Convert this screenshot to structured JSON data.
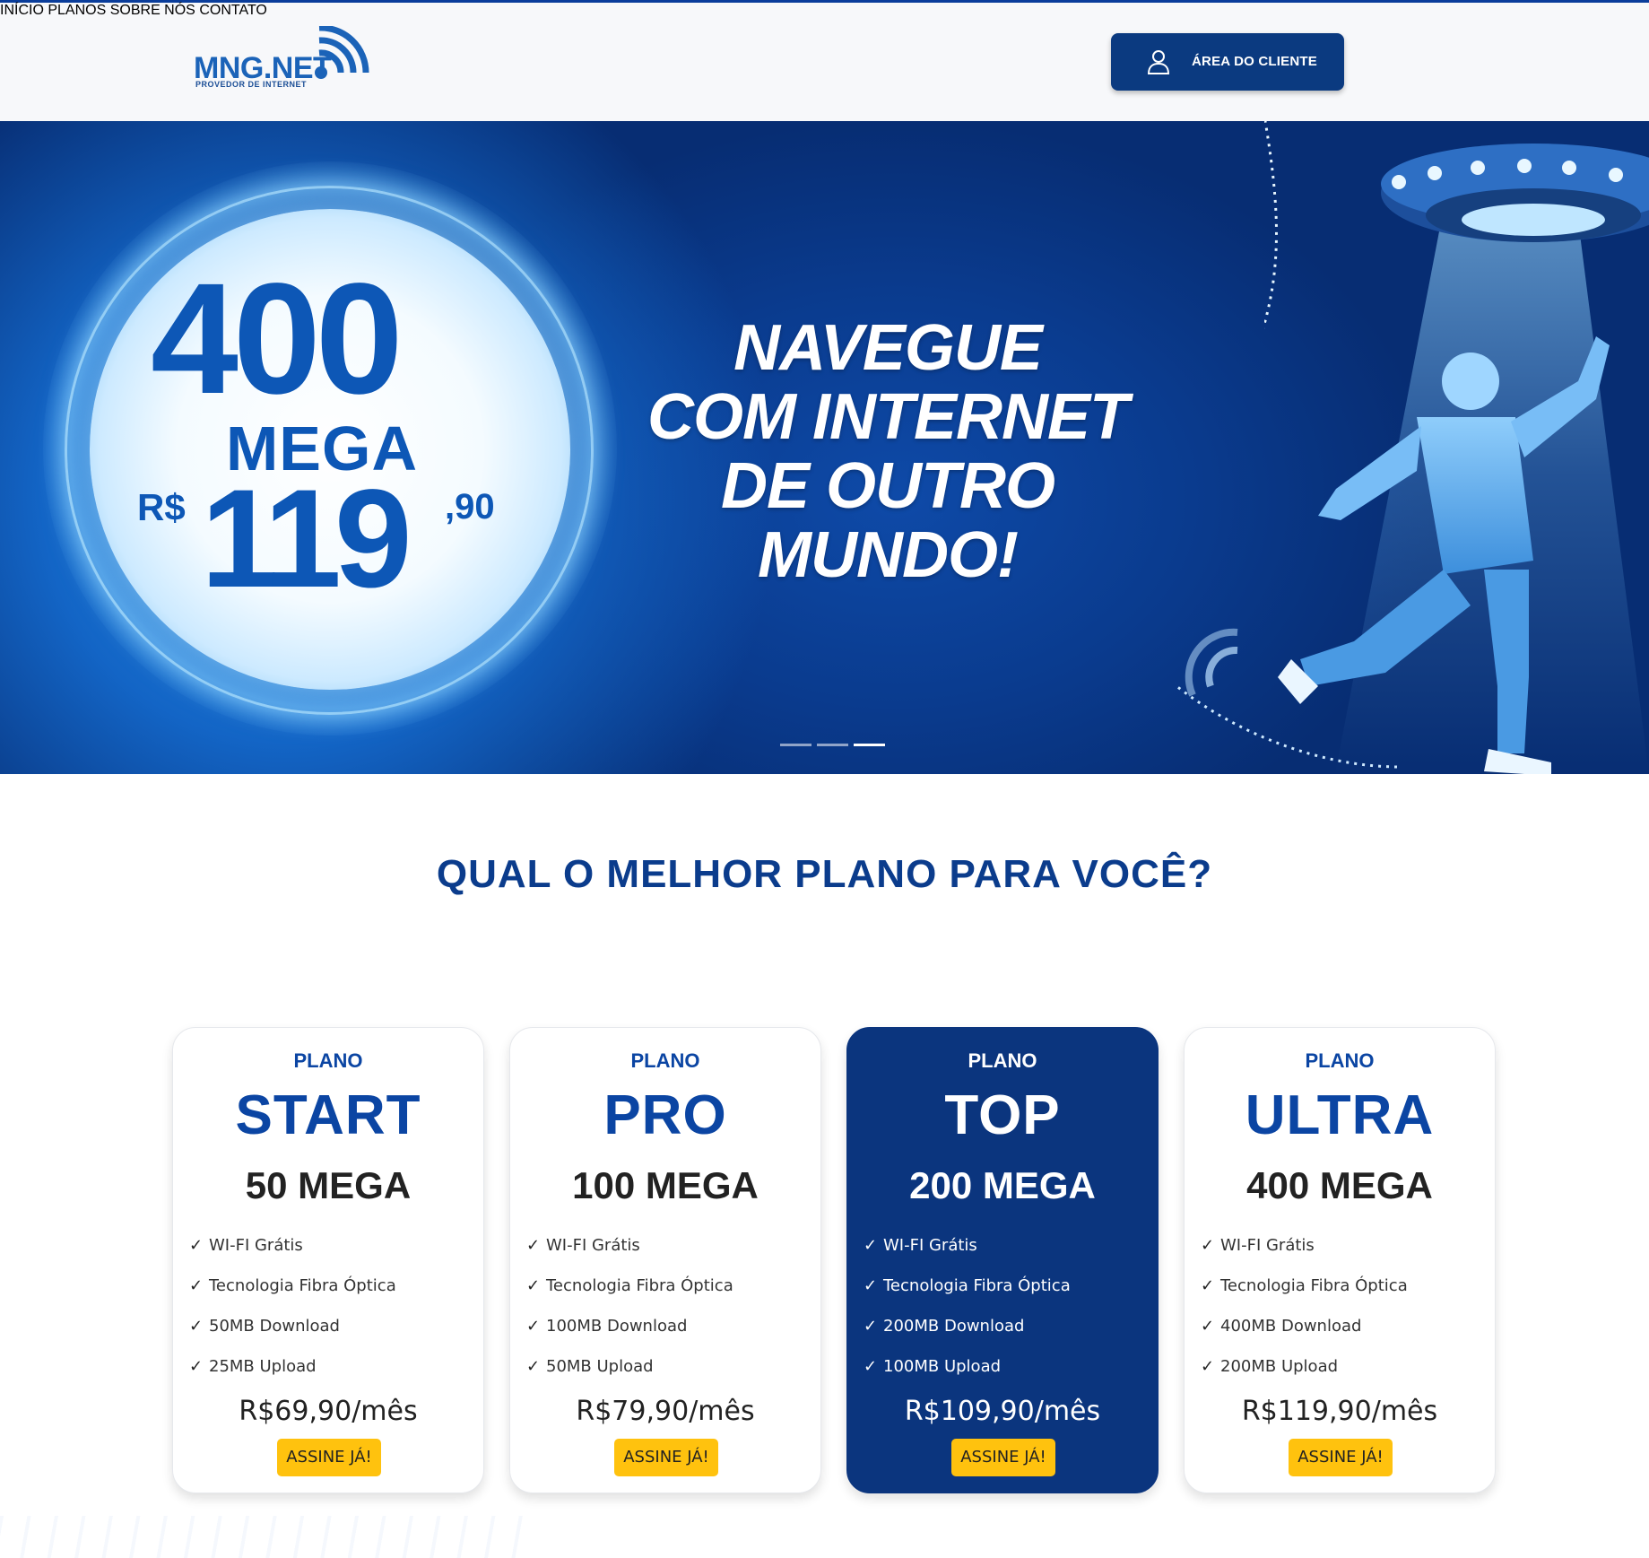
{
  "header": {
    "logo_text": "MNG.NET",
    "logo_subtitle": "PROVEDOR DE INTERNET",
    "nav": [
      "INÍCIO",
      "PLANOS",
      "SOBRE NÓS",
      "CONTATO"
    ],
    "client_area_label": "ÁREA DO CLIENTE"
  },
  "hero": {
    "speed": "400",
    "unit": "MEGA",
    "currency": "R$",
    "price_int": "119",
    "price_cents": ",90",
    "slogan_lines": [
      "NAVEGUE",
      "COM INTERNET",
      "DE OUTRO",
      "MUNDO!"
    ],
    "slides_total": 3,
    "active_slide": 3
  },
  "plans_section": {
    "title": "QUAL O MELHOR PLANO PARA VOCÊ?",
    "plans": [
      {
        "label": "PLANO",
        "name": "START",
        "speed": "50 MEGA",
        "features": [
          "WI-FI Grátis",
          "Tecnologia Fibra Óptica",
          "50MB Download",
          "25MB Upload"
        ],
        "price": "R$69,90/mês",
        "cta": "ASSINE JÁ!",
        "featured": false
      },
      {
        "label": "PLANO",
        "name": "PRO",
        "speed": "100 MEGA",
        "features": [
          "WI-FI Grátis",
          "Tecnologia Fibra Óptica",
          "100MB Download",
          "50MB Upload"
        ],
        "price": "R$79,90/mês",
        "cta": "ASSINE JÁ!",
        "featured": false
      },
      {
        "label": "PLANO",
        "name": "TOP",
        "speed": "200 MEGA",
        "features": [
          "WI-FI Grátis",
          "Tecnologia Fibra Óptica",
          "200MB Download",
          "100MB Upload"
        ],
        "price": "R$109,90/mês",
        "cta": "ASSINE JÁ!",
        "featured": true
      },
      {
        "label": "PLANO",
        "name": "ULTRA",
        "speed": "400 MEGA",
        "features": [
          "WI-FI Grátis",
          "Tecnologia Fibra Óptica",
          "400MB Download",
          "200MB Upload"
        ],
        "price": "R$119,90/mês",
        "cta": "ASSINE JÁ!",
        "featured": false
      }
    ]
  },
  "colors": {
    "primary": "#0b3c8c",
    "featured_card": "#0b357e",
    "cta": "#ffc20e",
    "logo_blue": "#1b63b8"
  },
  "icons": {
    "logo": "wifi-waves-icon",
    "client_area": "user-icon",
    "feature_bullet": "check-icon"
  }
}
